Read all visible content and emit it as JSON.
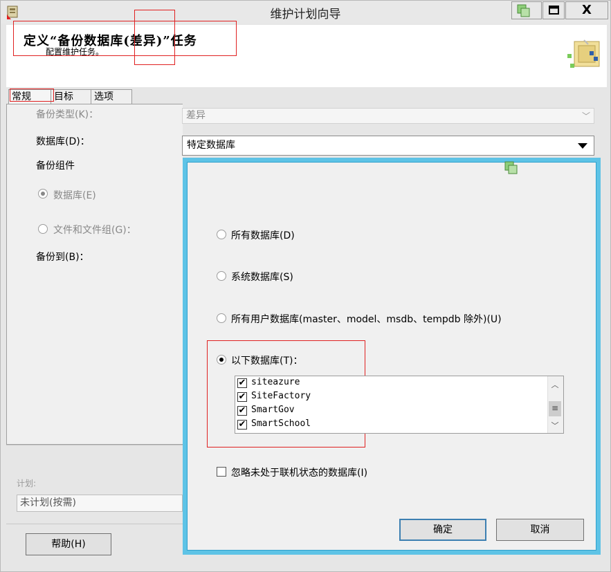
{
  "window": {
    "title": "维护计划向导",
    "close_label": "X"
  },
  "header": {
    "title": "定义“备份数据库(差异)”任务",
    "subtitle": "配置维护任务。"
  },
  "tabs": [
    {
      "label": "常规"
    },
    {
      "label": "目标"
    },
    {
      "label": "选项"
    }
  ],
  "form": {
    "backup_type_label": "备份类型(K)：",
    "backup_type_value": "差异",
    "database_label": "数据库(D)：",
    "database_value": "特定数据库",
    "backup_component_label": "备份组件",
    "component_options": [
      {
        "label": "数据库(E)",
        "selected": true
      },
      {
        "label": "文件和文件组(G)：",
        "selected": false
      }
    ],
    "backup_to_label": "备份到(B)：",
    "schedule_label": "计划:",
    "schedule_value": "未计划(按需)"
  },
  "popup": {
    "options": [
      {
        "label": "所有数据库(D)",
        "selected": false
      },
      {
        "label": "系统数据库(S)",
        "selected": false
      },
      {
        "label": "所有用户数据库(master、model、msdb、tempdb 除外)(U)",
        "selected": false
      },
      {
        "label": "以下数据库(T)：",
        "selected": true
      }
    ],
    "databases": [
      {
        "name": "siteazure",
        "checked": true
      },
      {
        "name": "SiteFactory",
        "checked": true
      },
      {
        "name": "SmartGov",
        "checked": true
      },
      {
        "name": "SmartSchool",
        "checked": true
      }
    ],
    "ignore_offline_label": "忽略未处于联机状态的数据库(I)",
    "ignore_offline_checked": false,
    "ok_label": "确定",
    "cancel_label": "取消"
  },
  "footer": {
    "help_label": "帮助(H)"
  },
  "colors": {
    "popup_border": "#5ec3e6",
    "annotation_red": "#e02020",
    "ok_border": "#3c7fb1"
  }
}
